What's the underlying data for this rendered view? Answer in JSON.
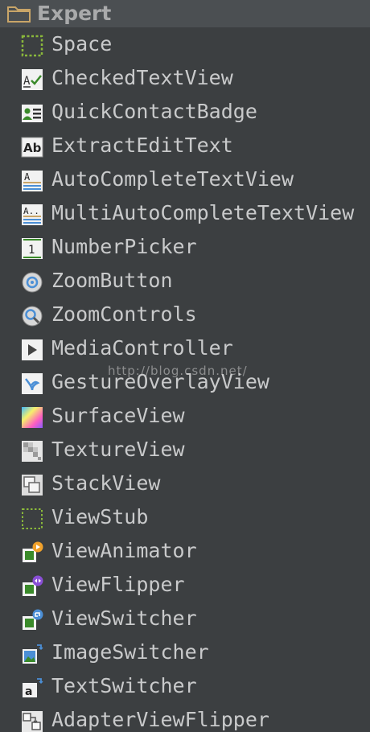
{
  "group": {
    "title": "Expert",
    "icon": "folder-icon"
  },
  "items": [
    {
      "label": "Space",
      "icon": "space-icon"
    },
    {
      "label": "CheckedTextView",
      "icon": "checked-text-view-icon"
    },
    {
      "label": "QuickContactBadge",
      "icon": "quick-contact-badge-icon"
    },
    {
      "label": "ExtractEditText",
      "icon": "extract-edit-text-icon"
    },
    {
      "label": "AutoCompleteTextView",
      "icon": "auto-complete-text-view-icon"
    },
    {
      "label": "MultiAutoCompleteTextView",
      "icon": "multi-auto-complete-text-view-icon"
    },
    {
      "label": "NumberPicker",
      "icon": "number-picker-icon"
    },
    {
      "label": "ZoomButton",
      "icon": "zoom-button-icon"
    },
    {
      "label": "ZoomControls",
      "icon": "zoom-controls-icon"
    },
    {
      "label": "MediaController",
      "icon": "media-controller-icon"
    },
    {
      "label": "GestureOverlayView",
      "icon": "gesture-overlay-view-icon"
    },
    {
      "label": "SurfaceView",
      "icon": "surface-view-icon"
    },
    {
      "label": "TextureView",
      "icon": "texture-view-icon"
    },
    {
      "label": "StackView",
      "icon": "stack-view-icon"
    },
    {
      "label": "ViewStub",
      "icon": "view-stub-icon"
    },
    {
      "label": "ViewAnimator",
      "icon": "view-animator-icon"
    },
    {
      "label": "ViewFlipper",
      "icon": "view-flipper-icon"
    },
    {
      "label": "ViewSwitcher",
      "icon": "view-switcher-icon"
    },
    {
      "label": "ImageSwitcher",
      "icon": "image-switcher-icon"
    },
    {
      "label": "TextSwitcher",
      "icon": "text-switcher-icon"
    },
    {
      "label": "AdapterViewFlipper",
      "icon": "adapter-view-flipper-icon"
    }
  ],
  "watermark": "http://blog.csdn.net/",
  "colors": {
    "background": "#3c3f41",
    "header_background": "#4b4f52",
    "text": "#c9cacb",
    "folder": "#c9a568",
    "accent_green": "#8ab83b"
  }
}
